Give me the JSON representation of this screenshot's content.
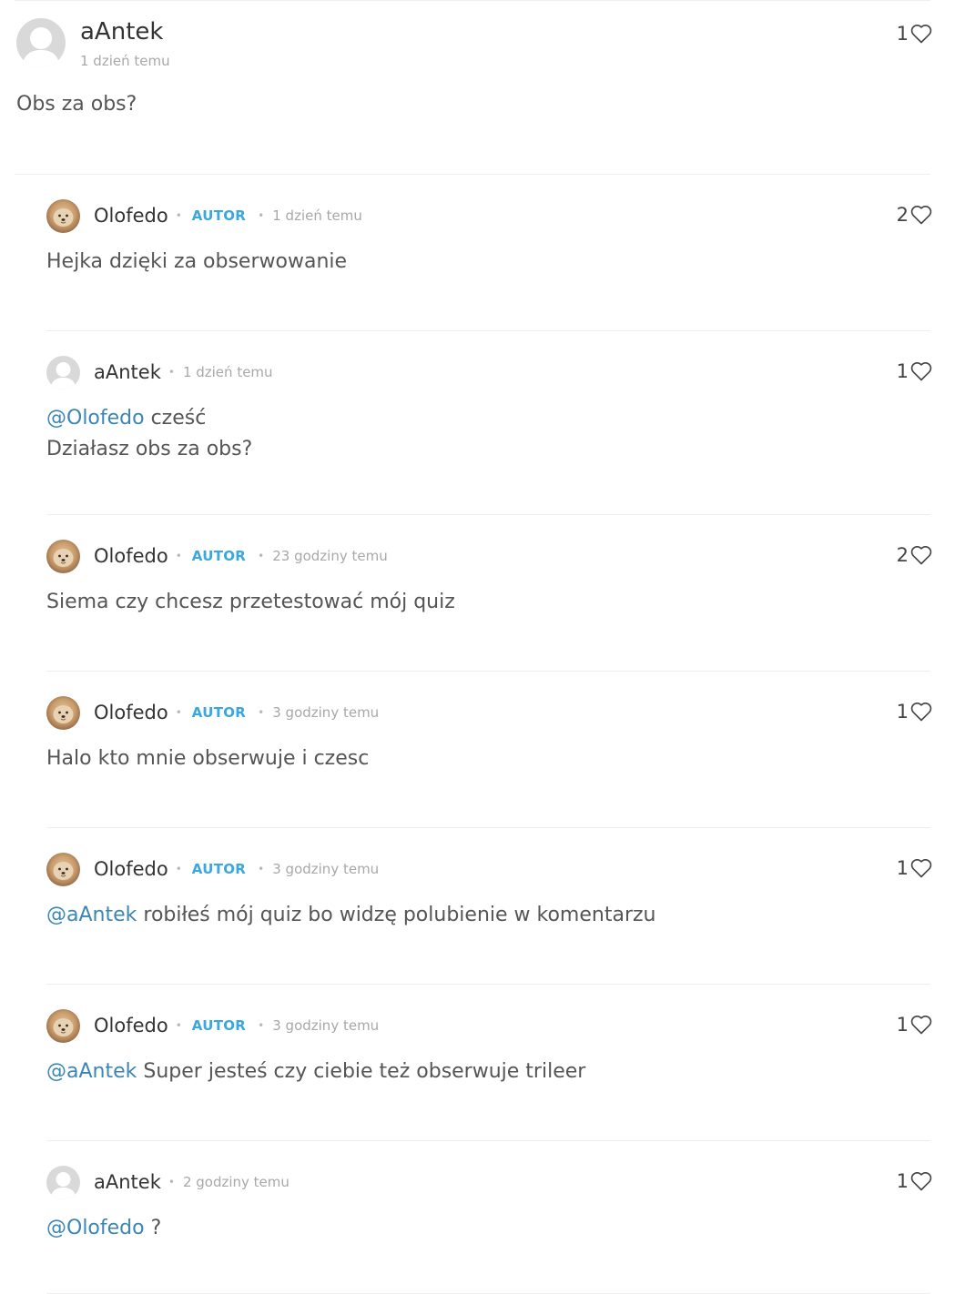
{
  "main_comment": {
    "author": "aAntek",
    "time": "1 dzień temu",
    "text": "Obs za obs?",
    "likes": "1"
  },
  "author_badge": "AUTOR",
  "replies": [
    {
      "author": "Olofedo",
      "is_author": true,
      "time": "1 dzień temu",
      "likes": "2",
      "mention": "",
      "text": "Hejka dzięki za obserwowanie",
      "line2": ""
    },
    {
      "author": "aAntek",
      "is_author": false,
      "time": "1 dzień temu",
      "likes": "1",
      "mention": "@Olofedo",
      "text": " cześć",
      "line2": "Działasz obs za obs?"
    },
    {
      "author": "Olofedo",
      "is_author": true,
      "time": "23 godziny temu",
      "likes": "2",
      "mention": "",
      "text": "Siema czy chcesz przetestować mój quiz",
      "line2": ""
    },
    {
      "author": "Olofedo",
      "is_author": true,
      "time": "3 godziny temu",
      "likes": "1",
      "mention": "",
      "text": "Halo kto mnie obserwuje i czesc",
      "line2": ""
    },
    {
      "author": "Olofedo",
      "is_author": true,
      "time": "3 godziny temu",
      "likes": "1",
      "mention": "@aAntek",
      "text": " robiłeś mój quiz bo widzę polubienie w komentarzu",
      "line2": ""
    },
    {
      "author": "Olofedo",
      "is_author": true,
      "time": "3 godziny temu",
      "likes": "1",
      "mention": "@aAntek",
      "text": " Super jesteś czy ciebie też obserwuje trileer",
      "line2": ""
    },
    {
      "author": "aAntek",
      "is_author": false,
      "time": "2 godziny temu",
      "likes": "1",
      "mention": "@Olofedo",
      "text": " ?",
      "line2": ""
    }
  ],
  "colors": {
    "mention": "#3b86b5",
    "autor_badge": "#3aa7df",
    "meta_text": "#a8a8a8"
  },
  "icons": {
    "like": "heart-outline-icon",
    "default_avatar": "default-user-avatar-icon",
    "olofedo_avatar": "dog-photo-avatar"
  }
}
